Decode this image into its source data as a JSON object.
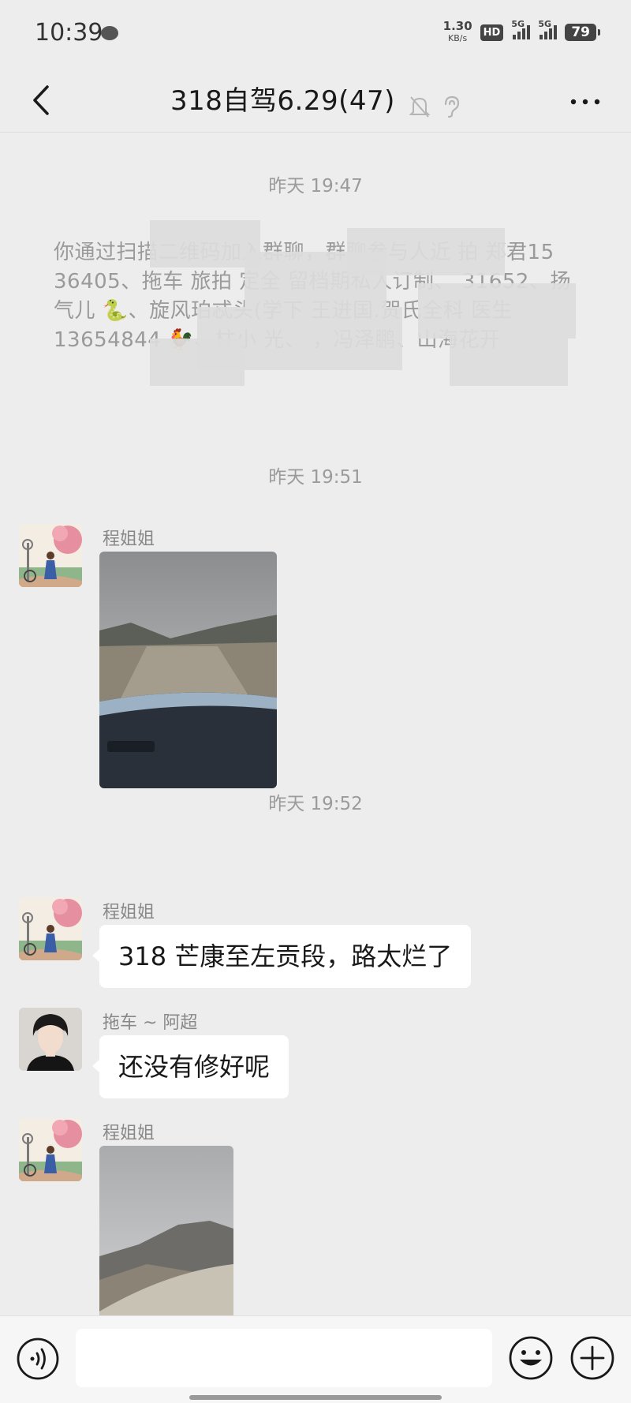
{
  "status_bar": {
    "time": "10:39",
    "net_speed_value": "1.30",
    "net_speed_unit": "KB/s",
    "hd_label": "HD",
    "signal1_label": "5G",
    "signal2_label": "5G",
    "battery": "79"
  },
  "header": {
    "title": "318自驾6.29(47)",
    "icons": [
      "back-icon",
      "mute-bell-icon",
      "ear-icon",
      "more-icon"
    ]
  },
  "chat": {
    "time_sep_1": "昨天 19:47",
    "system_message": "你通过扫描二维码加入群聊，群聊参与人近 拍  郑君15 36405、拖车 旅拍 定全 留档期私人订制、 31652、扬气儿 🐍、旋风珀忒头(学下 王进国.贺氏全科 医生13654844 🐓、柱小 光、 ，冯泽鹏、山海花开",
    "time_sep_2": "昨天 19:51",
    "msg1_sender": "程姐姐",
    "time_sep_3": "昨天 19:52",
    "msg2_sender": "程姐姐",
    "msg2_text": "318 芒康至左贡段，路太烂了",
    "msg3_sender": "拖车 ~ 阿超",
    "msg3_text": "还没有修好呢",
    "msg4_sender": "程姐姐"
  },
  "input_bar": {
    "placeholder": "",
    "icons": [
      "voice-icon",
      "emoji-icon",
      "plus-icon"
    ]
  },
  "colors": {
    "background": "#ededed",
    "bubble": "#ffffff",
    "meta_text": "#9b9b9b"
  }
}
